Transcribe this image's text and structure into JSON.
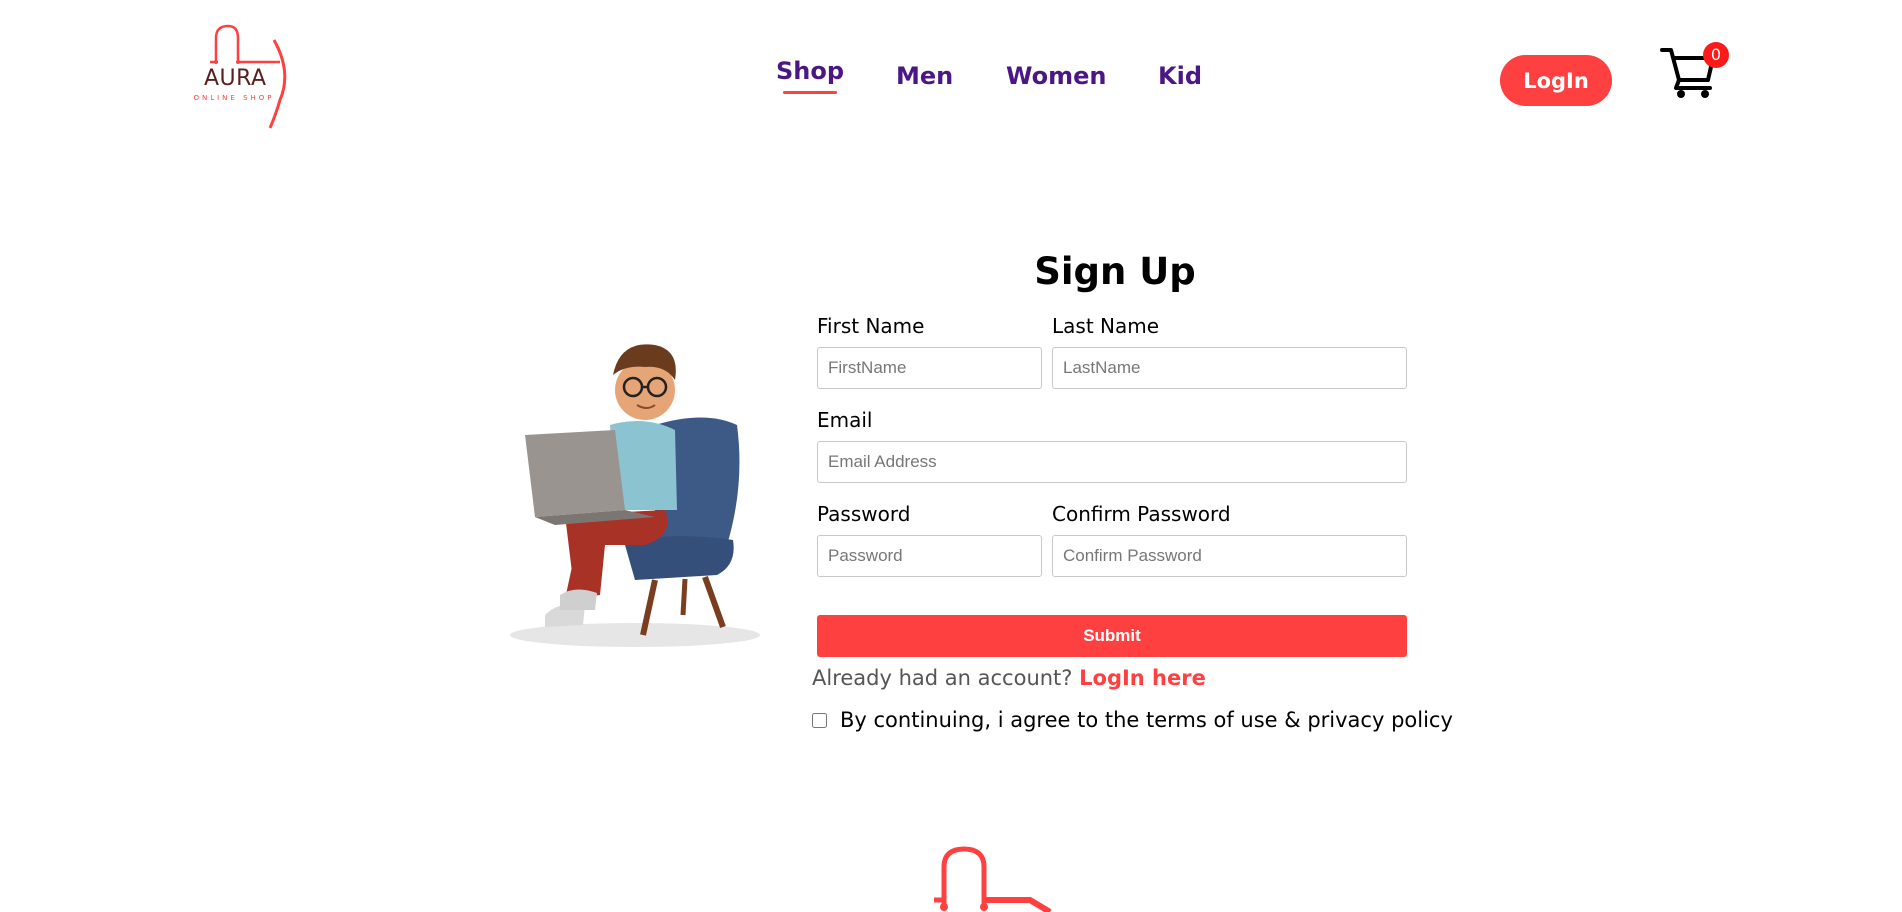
{
  "brand": {
    "name": "AURA",
    "tagline": "ONLINE SHOP",
    "accent": "#ff4040",
    "nav_color": "#4b1785"
  },
  "nav": {
    "items": [
      {
        "label": "Shop",
        "active": true
      },
      {
        "label": "Men",
        "active": false
      },
      {
        "label": "Women",
        "active": false
      },
      {
        "label": "Kid",
        "active": false
      }
    ]
  },
  "header": {
    "login_label": "LogIn",
    "cart_icon": "shopping-cart-icon",
    "cart_count": "0"
  },
  "form": {
    "title": "Sign Up",
    "first_name": {
      "label": "First Name",
      "placeholder": "FirstName",
      "value": ""
    },
    "last_name": {
      "label": "Last Name",
      "placeholder": "LastName",
      "value": ""
    },
    "email": {
      "label": "Email",
      "placeholder": "Email Address",
      "value": ""
    },
    "password": {
      "label": "Password",
      "placeholder": "Password",
      "value": ""
    },
    "confirm_password": {
      "label": "Confirm Password",
      "placeholder": "Confirm Password",
      "value": ""
    },
    "submit_label": "Submit",
    "already_text": "Already had an account?",
    "login_link": "LogIn here",
    "terms_text": "By continuing, i agree to the terms of use & privacy policy",
    "terms_checked": false
  },
  "illustration": {
    "icon": "man-with-laptop-illustration"
  }
}
